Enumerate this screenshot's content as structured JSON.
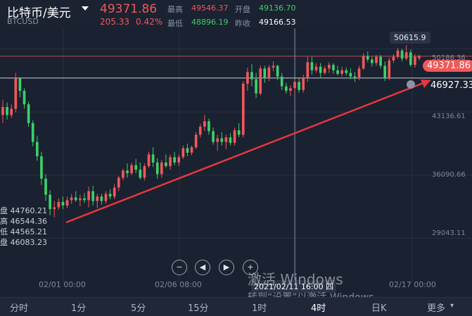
{
  "header": {
    "symbol": "比特币/美元",
    "code": "BTCUSD",
    "price": "49371.86",
    "change": "205.33",
    "change_pct": "0.42%",
    "high_label": "最高",
    "high": "49546.37",
    "open_label": "开盘",
    "open": "49136.70",
    "low_label": "最低",
    "low": "48896.19",
    "prev_label": "昨收",
    "prev": "49166.53"
  },
  "y_axis": [
    "50186.36",
    "43136.61",
    "36090.66",
    "29043.11"
  ],
  "x_axis": [
    "02/01 00:00",
    "02/06 08:00",
    "02/17 00:00"
  ],
  "tooltip_time": "2021/02/11 16:00 四",
  "ohlc_panel": {
    "open_label": "盘",
    "open": "44760.21",
    "high_label": "高",
    "high": "46544.36",
    "low_label": "低",
    "low": "44565.21",
    "close_label": "盘",
    "close": "46083.23"
  },
  "max_marker": "50615.9",
  "last_price_tag": "49371.86",
  "cursor_price_tag": "46927.33",
  "nav": {
    "zoom_out": "−",
    "prev": "◀",
    "next": "▶",
    "zoom_in": "+"
  },
  "tabs": [
    "分时",
    "1分",
    "5分",
    "15分",
    "1时",
    "4时",
    "日K",
    "更多"
  ],
  "tabs_more_caret": "▾",
  "watermark": {
    "line1": "激活 Windows",
    "line2": "转到“设置”以激活 Windows。"
  },
  "colors": {
    "up": "#f0585a",
    "down": "#3ecf6a",
    "background": "#1a2130",
    "trendline": "#e8373d"
  },
  "chart_data": {
    "type": "candlestick",
    "y_range": [
      25000,
      52500
    ],
    "candles": [
      [
        42800,
        44500,
        41900,
        43700
      ],
      [
        43700,
        44200,
        42300,
        42800
      ],
      [
        42800,
        44000,
        42500,
        43500
      ],
      [
        43500,
        47500,
        43100,
        46900
      ],
      [
        46900,
        47000,
        44800,
        45500
      ],
      [
        45500,
        45800,
        43500,
        44000
      ],
      [
        44000,
        44300,
        41500,
        41900
      ],
      [
        41900,
        42200,
        39300,
        39800
      ],
      [
        39800,
        40500,
        37700,
        38200
      ],
      [
        38200,
        38700,
        35000,
        35700
      ],
      [
        35700,
        36200,
        33200,
        33900
      ],
      [
        33900,
        34400,
        31600,
        32300
      ],
      [
        32300,
        33200,
        31400,
        32500
      ],
      [
        32500,
        33500,
        32200,
        33100
      ],
      [
        33100,
        33700,
        32300,
        32700
      ],
      [
        32700,
        33700,
        32400,
        33300
      ],
      [
        33300,
        34000,
        32900,
        33600
      ],
      [
        33600,
        34300,
        33100,
        33300
      ],
      [
        33300,
        33900,
        32600,
        33500
      ],
      [
        33500,
        34100,
        33000,
        33300
      ],
      [
        33300,
        34800,
        32500,
        34300
      ],
      [
        34300,
        34900,
        32700,
        33200
      ],
      [
        33200,
        34000,
        32400,
        33700
      ],
      [
        33700,
        34000,
        32800,
        33200
      ],
      [
        33200,
        34300,
        32900,
        34000
      ],
      [
        34000,
        34500,
        33400,
        33700
      ],
      [
        33700,
        35100,
        33400,
        34700
      ],
      [
        34700,
        36000,
        34300,
        35800
      ],
      [
        35800,
        36800,
        35500,
        36600
      ],
      [
        36600,
        37400,
        35800,
        36300
      ],
      [
        36300,
        37500,
        36100,
        37200
      ],
      [
        37200,
        37900,
        36300,
        36700
      ],
      [
        36700,
        37500,
        35600,
        35800
      ],
      [
        35800,
        37400,
        35500,
        37100
      ],
      [
        37100,
        38700,
        36900,
        38400
      ],
      [
        38400,
        39200,
        37000,
        37500
      ],
      [
        37500,
        38000,
        35700,
        36200
      ],
      [
        36200,
        37800,
        35800,
        37500
      ],
      [
        37500,
        38400,
        36900,
        37100
      ],
      [
        37100,
        38400,
        36700,
        38100
      ],
      [
        38100,
        38700,
        37200,
        37500
      ],
      [
        37500,
        38400,
        37100,
        38100
      ],
      [
        38100,
        39400,
        37900,
        39100
      ],
      [
        39100,
        39600,
        38200,
        38600
      ],
      [
        38600,
        39400,
        38300,
        39200
      ],
      [
        39200,
        40900,
        39000,
        40600
      ],
      [
        40600,
        41800,
        40300,
        41500
      ],
      [
        41500,
        42800,
        41000,
        42100
      ],
      [
        42100,
        42400,
        40600,
        41000
      ],
      [
        41000,
        41400,
        39500,
        39800
      ],
      [
        39800,
        40600,
        38800,
        40200
      ],
      [
        40200,
        40900,
        39400,
        39800
      ],
      [
        39800,
        40600,
        39000,
        40300
      ],
      [
        40300,
        40800,
        39400,
        39700
      ],
      [
        39700,
        41400,
        39400,
        41100
      ],
      [
        41100,
        41900,
        40300,
        40600
      ],
      [
        40600,
        46600,
        40300,
        46300
      ],
      [
        46300,
        48100,
        45500,
        47600
      ],
      [
        47600,
        48500,
        46000,
        46800
      ],
      [
        46800,
        47500,
        44700,
        45200
      ],
      [
        45200,
        48300,
        45000,
        48000
      ],
      [
        48000,
        48300,
        46400,
        46900
      ],
      [
        46900,
        48400,
        46600,
        48100
      ],
      [
        48100,
        48800,
        47700,
        48300
      ],
      [
        48300,
        48400,
        46700,
        47100
      ],
      [
        47100,
        47500,
        45600,
        46000
      ],
      [
        46000,
        46400,
        45200,
        45500
      ],
      [
        45500,
        46100,
        44900,
        45800
      ],
      [
        45800,
        46800,
        45300,
        46500
      ],
      [
        46500,
        46900,
        45300,
        45600
      ],
      [
        45600,
        47300,
        45300,
        47000
      ],
      [
        47000,
        49300,
        46500,
        48700
      ],
      [
        48700,
        49300,
        47300,
        47800
      ],
      [
        47800,
        48600,
        47500,
        48200
      ],
      [
        48200,
        48600,
        47000,
        47500
      ],
      [
        47500,
        48300,
        47300,
        48000
      ],
      [
        48000,
        48700,
        47500,
        48400
      ],
      [
        48400,
        48600,
        47400,
        47800
      ],
      [
        47800,
        48300,
        47200,
        47400
      ],
      [
        47400,
        48200,
        47100,
        47800
      ],
      [
        47800,
        48100,
        47200,
        47500
      ],
      [
        47500,
        48000,
        46800,
        47100
      ],
      [
        47100,
        47600,
        46500,
        46900
      ],
      [
        46900,
        48300,
        46700,
        48000
      ],
      [
        48000,
        49700,
        47800,
        49400
      ],
      [
        49400,
        49900,
        48700,
        49000
      ],
      [
        49000,
        49300,
        48200,
        48600
      ],
      [
        48600,
        49500,
        48300,
        49300
      ],
      [
        49300,
        49500,
        48000,
        48300
      ],
      [
        48300,
        48800,
        46600,
        46900
      ],
      [
        46900,
        49200,
        46700,
        48900
      ],
      [
        48900,
        49600,
        48600,
        49300
      ],
      [
        49300,
        50300,
        49100,
        50000
      ],
      [
        50000,
        50200,
        48800,
        49100
      ],
      [
        49100,
        50615.9,
        48900,
        49800
      ],
      [
        49800,
        50100,
        48200,
        48400
      ],
      [
        48400,
        49600,
        48100,
        49300
      ],
      [
        49136.7,
        49546.37,
        48896.19,
        49371.86
      ]
    ]
  }
}
